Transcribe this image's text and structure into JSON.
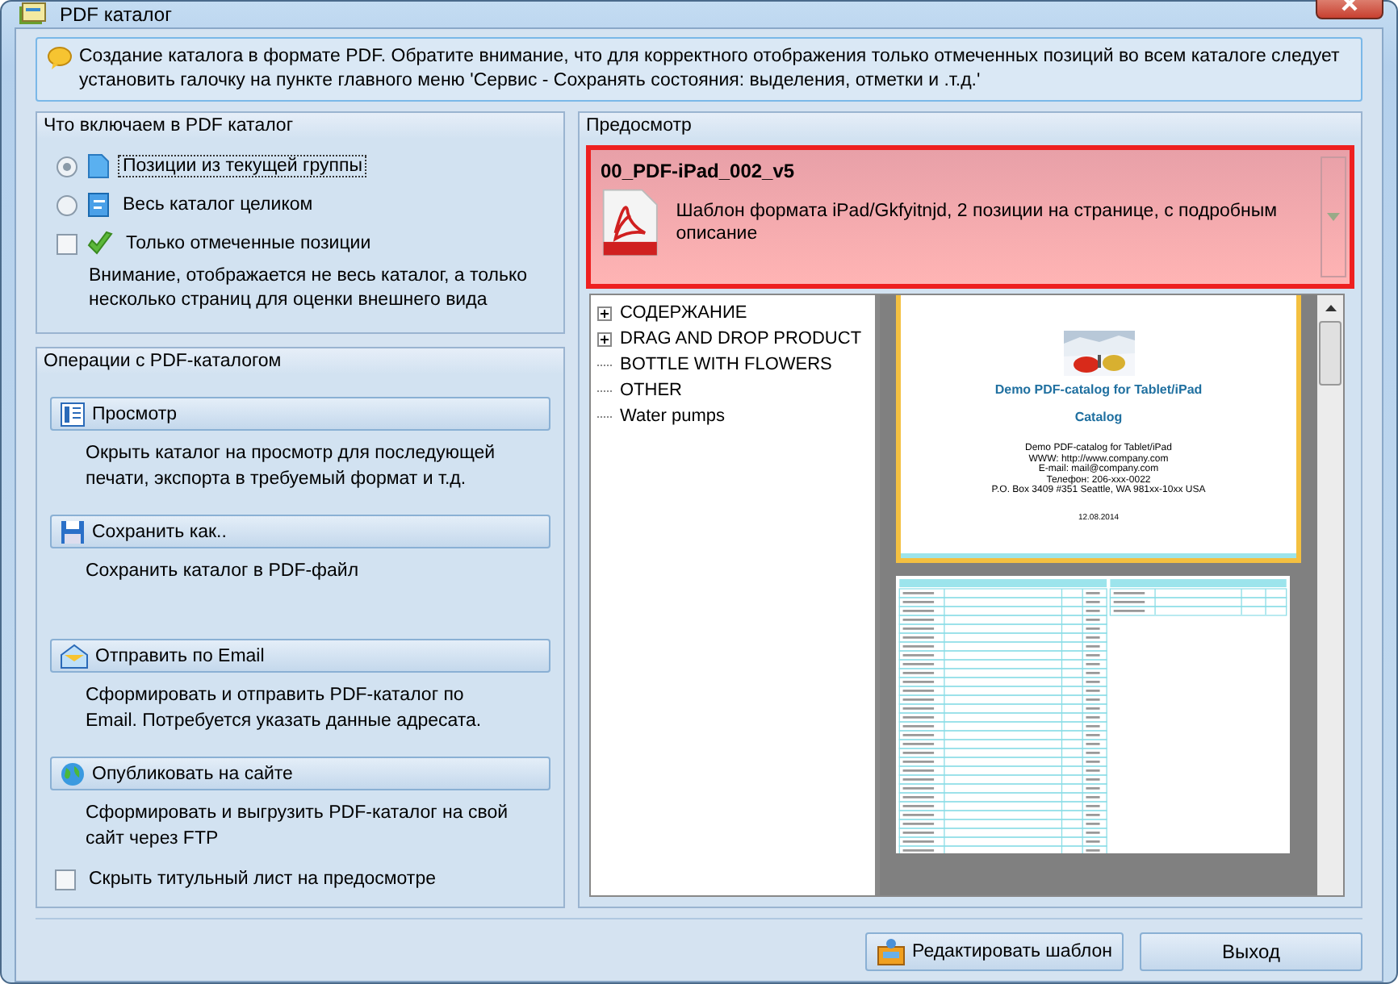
{
  "window": {
    "title": "PDF  каталог"
  },
  "info": "Создание каталога в формате PDF. Обратите внимание, что для корректного отображения только отмеченных позиций во всем каталоге следует установить галочку на пункте главного меню 'Сервис - Сохранять состояния: выделения, отметки и .т.д.'",
  "include_group": {
    "title": "Что включаем в PDF каталог",
    "options": [
      {
        "kind": "radio",
        "label": "Позиции из текущей группы",
        "selected": true
      },
      {
        "kind": "radio",
        "label": "Весь каталог целиком",
        "selected": false
      },
      {
        "kind": "checkbox",
        "label": "Только отмеченные позиции",
        "checked": false
      }
    ],
    "note": "Внимание, отображается не весь каталог, а только несколько страниц для оценки внешнего вида"
  },
  "operations_group": {
    "title": "Операции с PDF-каталогом",
    "actions": [
      {
        "label": "Просмотр",
        "description": "Окрыть каталог на просмотр для последующей печати, экспорта в требуемый формат и т.д."
      },
      {
        "label": "Сохранить как..",
        "description": "Сохранить каталог в PDF-файл"
      },
      {
        "label": "Отправить по Email",
        "description": "Сформировать и отправить PDF-каталог по Email. Потребуется указать данные адресата."
      },
      {
        "label": "Опубликовать на сайте",
        "description": "Сформировать и выгрузить PDF-каталог на свой сайт через FTP"
      }
    ],
    "hide_title_page": {
      "label": "Скрыть титульный лист на предосмотре",
      "checked": false
    }
  },
  "preview_group": {
    "title": "Предосмотр",
    "template": {
      "name": "00_PDF-iPad_002_v5",
      "description": "Шаблон формата  iPad/Gkfyitnjd, 2 позиции на  странице, с подробным описание",
      "highlighted": true
    },
    "tree": [
      {
        "label": "СОДЕРЖАНИЕ",
        "expandable": true
      },
      {
        "label": "DRAG AND DROP PRODUCT",
        "expandable": true
      },
      {
        "label": "BOTTLE WITH FLOWERS",
        "expandable": false
      },
      {
        "label": "OTHER",
        "expandable": false
      },
      {
        "label": "Water pumps",
        "expandable": false
      }
    ],
    "title_page": {
      "heading": "Demo PDF-catalog for Tablet/iPad",
      "subheading": "Catalog",
      "lines": [
        "Demo PDF-catalog for Tablet/iPad",
        "WWW: http://www.company.com",
        "E-mail: mail@company.com",
        "Телефон: 206-xxx-0022",
        "P.O. Box 3409 #351 Seattle, WA 981xx-10xx USA"
      ],
      "date": "12.08.2014"
    }
  },
  "buttons": [
    {
      "label": "Редактировать шаблон"
    },
    {
      "label": "Выход"
    }
  ]
}
